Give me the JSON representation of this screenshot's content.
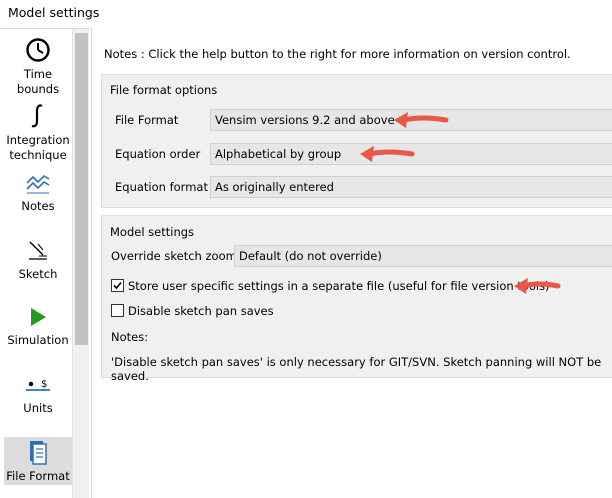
{
  "window": {
    "title": "Model settings"
  },
  "sidebar": {
    "items": [
      {
        "label_lines": [
          "Time",
          "bounds"
        ],
        "icon": "clock-icon"
      },
      {
        "label_lines": [
          "Integration",
          "technique"
        ],
        "icon": "integral-icon"
      },
      {
        "label_lines": [
          "Notes"
        ],
        "icon": "notes-graph-icon"
      },
      {
        "label_lines": [
          "Sketch"
        ],
        "icon": "sketch-icon"
      },
      {
        "label_lines": [
          "Simulation"
        ],
        "icon": "play-icon"
      },
      {
        "label_lines": [
          "Units"
        ],
        "icon": "units-icon"
      },
      {
        "label_lines": [
          "File Format"
        ],
        "icon": "document-icon",
        "selected": true
      }
    ]
  },
  "notes_line": "Notes : Click the help button to the right for more information on version control.",
  "file_format_options": {
    "title": "File format options",
    "file_format": {
      "label": "File Format",
      "value": "Vensim versions 9.2 and above"
    },
    "equation_order": {
      "label": "Equation order",
      "value": "Alphabetical by group"
    },
    "equation_format": {
      "label": "Equation format",
      "value": "As originally entered"
    }
  },
  "model_settings": {
    "title": "Model settings",
    "override_sketch_zoom": {
      "label": "Override sketch zoom",
      "value": "Default (do not override)"
    },
    "store_user_settings": {
      "label": "Store user specific settings in a separate file (useful for file version tools)",
      "checked": true
    },
    "disable_sketch_pan": {
      "label": "Disable sketch pan saves",
      "checked": false
    },
    "notes_label": "Notes:",
    "notes_text": "'Disable sketch pan saves' is only necessary for GIT/SVN. Sketch panning will NOT be saved."
  },
  "colors": {
    "annotation_arrow": "#e8574a",
    "selected_item": "#dcdcdc",
    "accent_icon": "#2f6fb5"
  }
}
